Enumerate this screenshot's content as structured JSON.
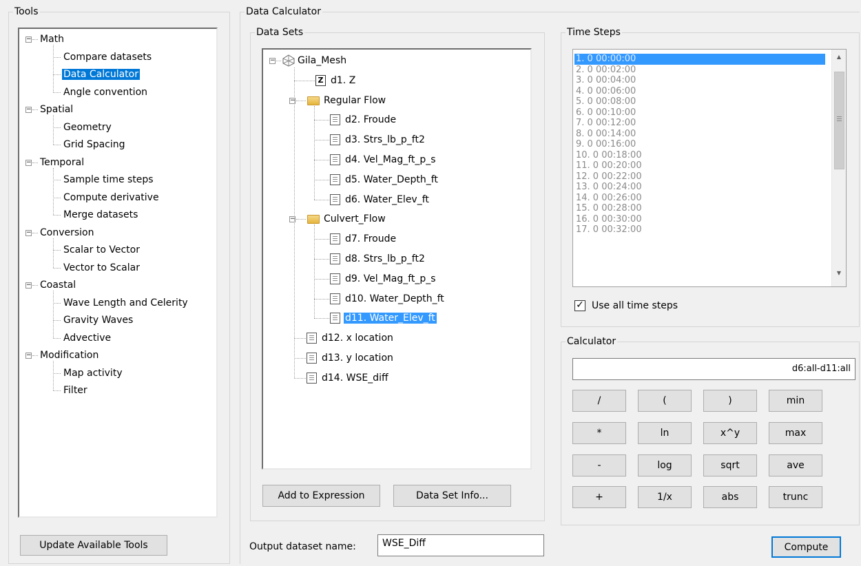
{
  "tools": {
    "title": "Tools",
    "tree": [
      {
        "label": "Math",
        "children": [
          "Compare datasets",
          "Data Calculator",
          "Angle convention"
        ]
      },
      {
        "label": "Spatial",
        "children": [
          "Geometry",
          "Grid Spacing"
        ]
      },
      {
        "label": "Temporal",
        "children": [
          "Sample time steps",
          "Compute derivative",
          "Merge datasets"
        ]
      },
      {
        "label": "Conversion",
        "children": [
          "Scalar to Vector",
          "Vector to Scalar"
        ]
      },
      {
        "label": "Coastal",
        "children": [
          "Wave Length and Celerity",
          "Gravity Waves",
          "Advective"
        ]
      },
      {
        "label": "Modification",
        "children": [
          "Map activity",
          "Filter"
        ]
      }
    ],
    "selected": "Data Calculator",
    "update_button": "Update Available Tools"
  },
  "calc": {
    "title": "Data Calculator",
    "datasets_title": "Data Sets",
    "mesh": "Gila_Mesh",
    "d1": "d1. Z",
    "regular_flow": "Regular Flow",
    "regular_items": [
      "d2. Froude",
      "d3. Strs_lb_p_ft2",
      "d4. Vel_Mag_ft_p_s",
      "d5. Water_Depth_ft",
      "d6. Water_Elev_ft"
    ],
    "culvert_flow": "Culvert_Flow",
    "culvert_items": [
      "d7. Froude",
      "d8. Strs_lb_p_ft2",
      "d9. Vel_Mag_ft_p_s",
      "d10. Water_Depth_ft",
      "d11. Water_Elev_ft"
    ],
    "bottom_items": [
      "d12. x location",
      "d13. y location",
      "d14. WSE_diff"
    ],
    "add_expression": "Add to Expression",
    "data_set_info": "Data Set Info...",
    "output_label": "Output dataset name:",
    "output_value": "WSE_Diff",
    "compute": "Compute"
  },
  "time_steps": {
    "title": "Time Steps",
    "items": [
      "1. 0 00:00:00",
      "2. 0 00:02:00",
      "3. 0 00:04:00",
      "4. 0 00:06:00",
      "5. 0 00:08:00",
      "6. 0 00:10:00",
      "7. 0 00:12:00",
      "8. 0 00:14:00",
      "9. 0 00:16:00",
      "10. 0 00:18:00",
      "11. 0 00:20:00",
      "12. 0 00:22:00",
      "13. 0 00:24:00",
      "14. 0 00:26:00",
      "15. 0 00:28:00",
      "16. 0 00:30:00",
      "17. 0 00:32:00"
    ],
    "use_all_label": "Use all time steps",
    "use_all_checked": true
  },
  "calculator": {
    "title": "Calculator",
    "expression": "d6:all-d11:all",
    "buttons": [
      [
        "/",
        "(",
        ")",
        "min"
      ],
      [
        "*",
        "ln",
        "x^y",
        "max"
      ],
      [
        "-",
        "log",
        "sqrt",
        "ave"
      ],
      [
        "+",
        "1/x",
        "abs",
        "trunc"
      ]
    ]
  }
}
